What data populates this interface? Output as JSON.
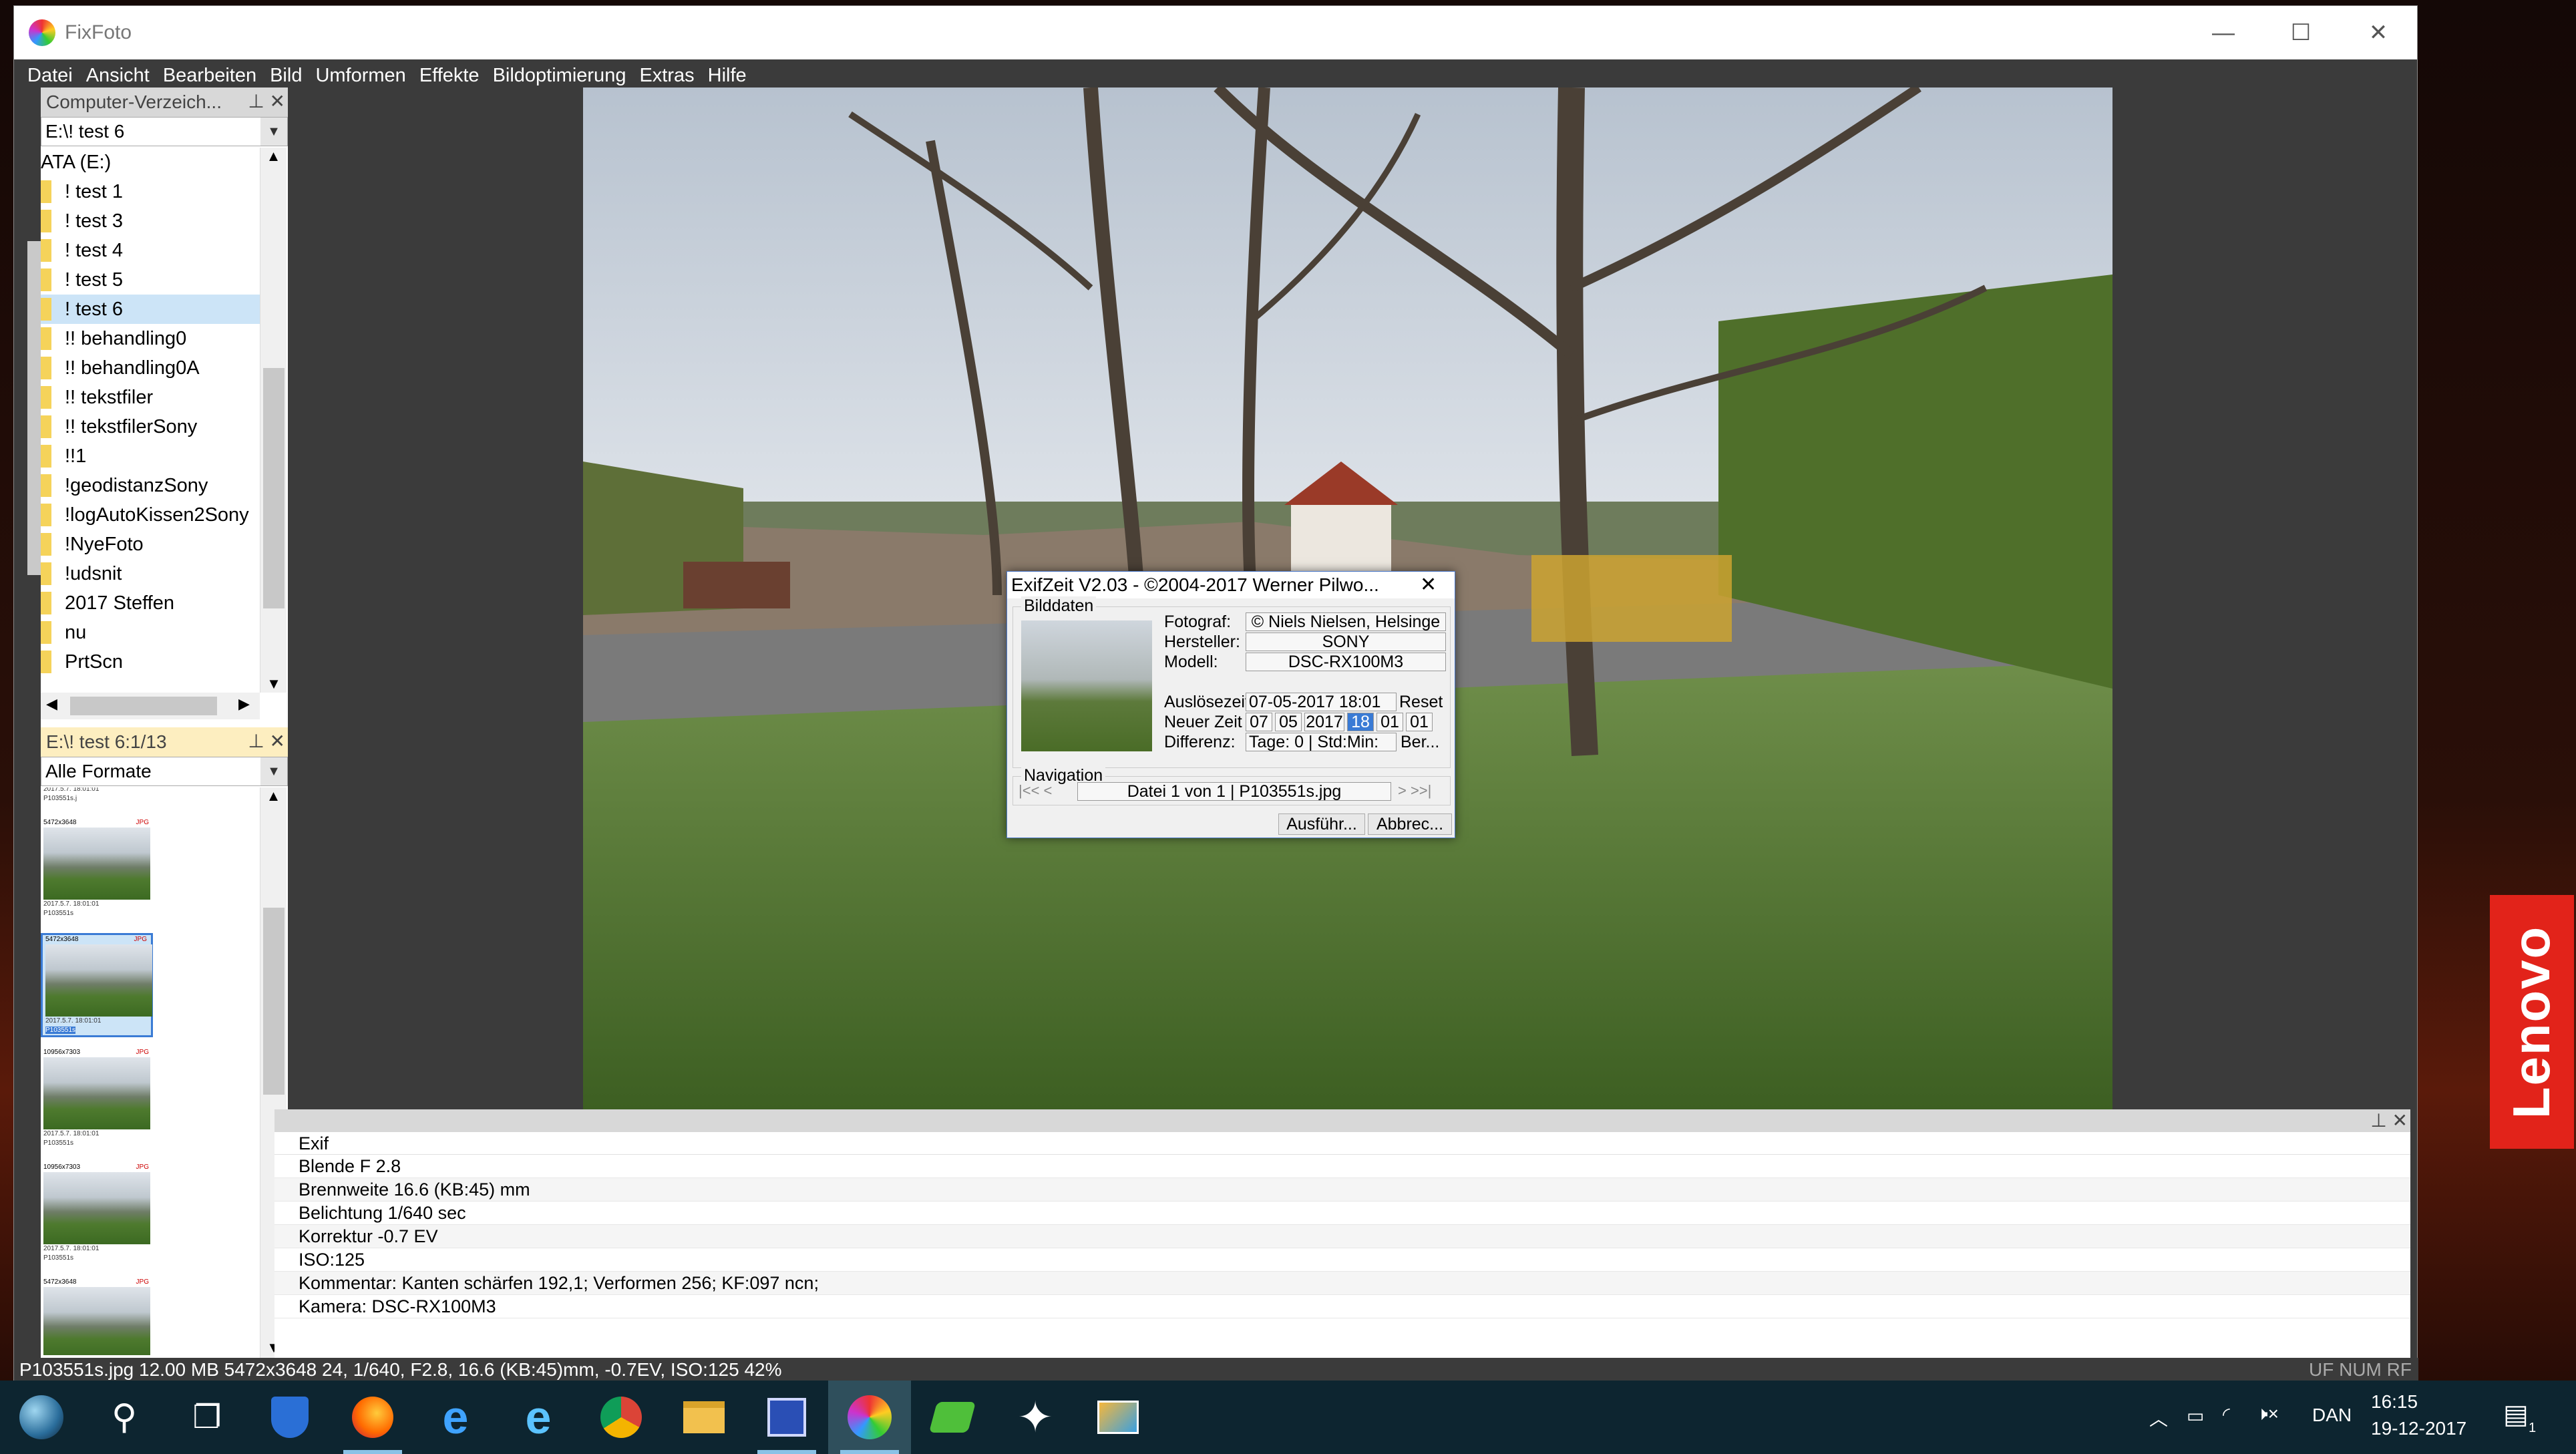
{
  "window": {
    "title": "FixFoto",
    "minimize": "—",
    "maximize": "☐",
    "close": "✕"
  },
  "menu": [
    "Datei",
    "Ansicht",
    "Bearbeiten",
    "Bild",
    "Umformen",
    "Effekte",
    "Bildoptimierung",
    "Extras",
    "Hilfe"
  ],
  "folder_panel": {
    "title": "Computer-Verzeich...",
    "path": "E:\\! test 6",
    "drive": "ATA (E:)",
    "items": [
      "! test 1",
      "! test 3",
      "! test 4",
      "! test 5",
      "! test 6",
      "!! behandling0",
      "!! behandling0A",
      "!! tekstfiler",
      "!! tekstfilerSony",
      "!!1",
      "!geodistanzSony",
      "!logAutoKissen2Sony",
      "!NyeFoto",
      "!udsnit",
      "2017 Steffen",
      "nu",
      "PrtScn"
    ],
    "selected": "! test 6"
  },
  "thumb_panel": {
    "title": "E:\\! test 6:1/13",
    "filter": "Alle Formate",
    "thumbs": [
      {
        "dims": "",
        "date": "2017.5.7. 18:01:01",
        "name": "P103551s.j"
      },
      {
        "dims": "5472x3648",
        "date": "2017.5.7. 18:01:01",
        "name": "P103551s"
      },
      {
        "dims": "5472x3648",
        "date": "2017.5.7. 18:01:01",
        "name": "P103551s"
      },
      {
        "dims": "10956x7303",
        "date": "2017.5.7. 18:01:01",
        "name": "P103551s"
      },
      {
        "dims": "10956x7303",
        "date": "2017.5.7. 18:01:01",
        "name": "P103551s"
      },
      {
        "dims": "5472x3648",
        "date": "",
        "name": ""
      }
    ],
    "format_badge": "JPG"
  },
  "dialog": {
    "title": "ExifZeit V2.03 - ©2004-2017 Werner Pilwo...",
    "close": "✕",
    "group_image": "Bilddaten",
    "photographer_label": "Fotograf:",
    "photographer_value": "© Niels Nielsen, Helsinge",
    "maker_label": "Hersteller:",
    "maker_value": "SONY",
    "model_label": "Modell:",
    "model_value": "DSC-RX100M3",
    "shutter_label": "Auslösezeit",
    "shutter_value": "07-05-2017 18:01",
    "reset": "Reset",
    "newtime_label": "Neuer Zeit",
    "newtime_parts": [
      "07",
      "05",
      "2017",
      "18",
      "01",
      "01"
    ],
    "diff_label": "Differenz:",
    "diff_value": "Tage: 0 | Std:Min:",
    "diff_btn": "Ber...",
    "group_nav": "Navigation",
    "nav_prev": "|<< <",
    "nav_value": "Datei 1 von 1 | P103551s.jpg",
    "nav_next": "> >>|",
    "run": "Ausführ...",
    "cancel": "Abbrec..."
  },
  "exif": {
    "header": "Exif",
    "rows": [
      "Blende F 2.8",
      "Brennweite 16.6 (KB:45) mm",
      "Belichtung 1/640 sec",
      "Korrektur -0.7 EV",
      "ISO:125",
      "Kommentar: Kanten schärfen 192,1; Verformen 256; KF:097 ncn;",
      "Kamera: DSC-RX100M3"
    ]
  },
  "statusbar": {
    "text": "P103551s.jpg  12.00 MB  5472x3648 24, 1/640, F2.8, 16.6 (KB:45)mm, -0.7EV, ISO:125 42%",
    "indicators": "UF NUM RF"
  },
  "taskbar": {
    "lang": "DAN",
    "time": "16:15",
    "date": "19-12-2017",
    "notification_count": "1"
  },
  "desktop": {
    "brand": "Lenovo"
  },
  "colors": {
    "window_bg": "#3b3b3b",
    "panel_active": "#fdeec0",
    "selection": "#cce4f7",
    "lenovo_red": "#e2231a",
    "taskbar": "#0d2530"
  }
}
